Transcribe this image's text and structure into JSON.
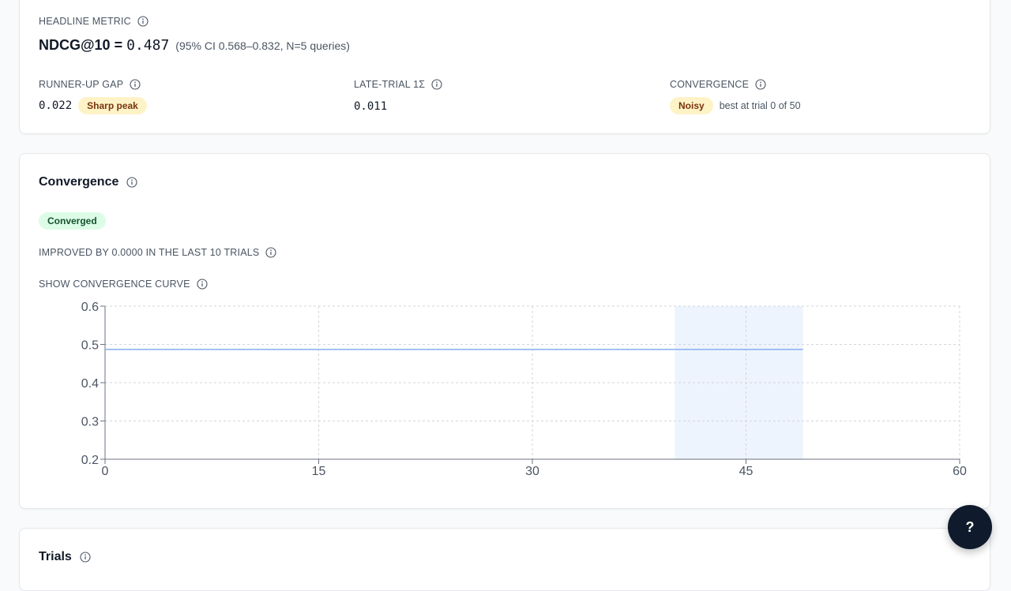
{
  "summary": {
    "headline_label": "HEADLINE METRIC",
    "headline_metric_name": "NDCG@10 =",
    "headline_metric_value": "0.487",
    "headline_ci": "(95% CI 0.568–0.832, N=5 queries)",
    "runner_up": {
      "label": "RUNNER-UP GAP",
      "value": "0.022",
      "badge": "Sharp peak"
    },
    "late_trial": {
      "label": "LATE-TRIAL 1Σ",
      "value": "0.011"
    },
    "convergence": {
      "label": "CONVERGENCE",
      "badge": "Noisy",
      "note": "best at trial 0 of 50"
    }
  },
  "convergence_card": {
    "title": "Convergence",
    "status_badge": "Converged",
    "improved_text": "IMPROVED BY 0.0000 IN THE LAST 10 TRIALS",
    "toggle_label": "SHOW CONVERGENCE CURVE"
  },
  "trials_card": {
    "title": "Trials"
  },
  "help_button": {
    "label": "?"
  },
  "icons": {
    "info": "info-circle-icon"
  },
  "colors": {
    "line": "#8fb3f0",
    "band": "#eef4fd",
    "warn_badge_bg": "#fef3c7",
    "ok_badge_bg": "#dcfce7",
    "help_bg": "#0f1b2d"
  },
  "chart_data": {
    "type": "line",
    "title": "",
    "xlabel": "",
    "ylabel": "",
    "xlim": [
      0,
      60
    ],
    "ylim": [
      0.2,
      0.6
    ],
    "x_ticks": [
      0,
      15,
      30,
      45,
      60
    ],
    "y_ticks": [
      0.2,
      0.3,
      0.4,
      0.5,
      0.6
    ],
    "x_tick_labels": [
      "0",
      "15",
      "30",
      "45",
      "60"
    ],
    "y_tick_labels": [
      "0.2",
      "0.3",
      "0.4",
      "0.5",
      "0.6"
    ],
    "grid": true,
    "highlight_range": [
      40,
      49
    ],
    "series": [
      {
        "x": [
          0,
          49
        ],
        "y": [
          0.487,
          0.487
        ]
      }
    ]
  }
}
